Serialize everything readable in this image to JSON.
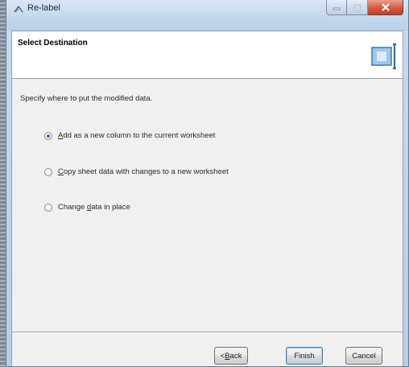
{
  "window": {
    "title": "Re-label",
    "icon": "relabel-app-icon",
    "controls": {
      "minimize": "minimize-icon",
      "maximize": "maximize-icon",
      "close": "close-icon"
    }
  },
  "header": {
    "title": "Select Destination",
    "icon": "wizard-destination-icon"
  },
  "body": {
    "instruction": "Specify where to put the modified data."
  },
  "options": [
    {
      "pre": "",
      "access": "A",
      "post": "dd as a new column to the current worksheet",
      "checked": true
    },
    {
      "pre": "",
      "access": "C",
      "post": "opy sheet data with changes to a new worksheet",
      "checked": false
    },
    {
      "pre": "Change ",
      "access": "d",
      "post": "ata in place",
      "checked": false
    }
  ],
  "buttons": {
    "back_pre": "< ",
    "back_access": "B",
    "back_post": "ack",
    "finish": "Finish",
    "cancel": "Cancel"
  },
  "colors": {
    "radio_dot": "#3a6db3",
    "default_button_border": "#3c7fb1",
    "close_button": "#c2401f"
  }
}
